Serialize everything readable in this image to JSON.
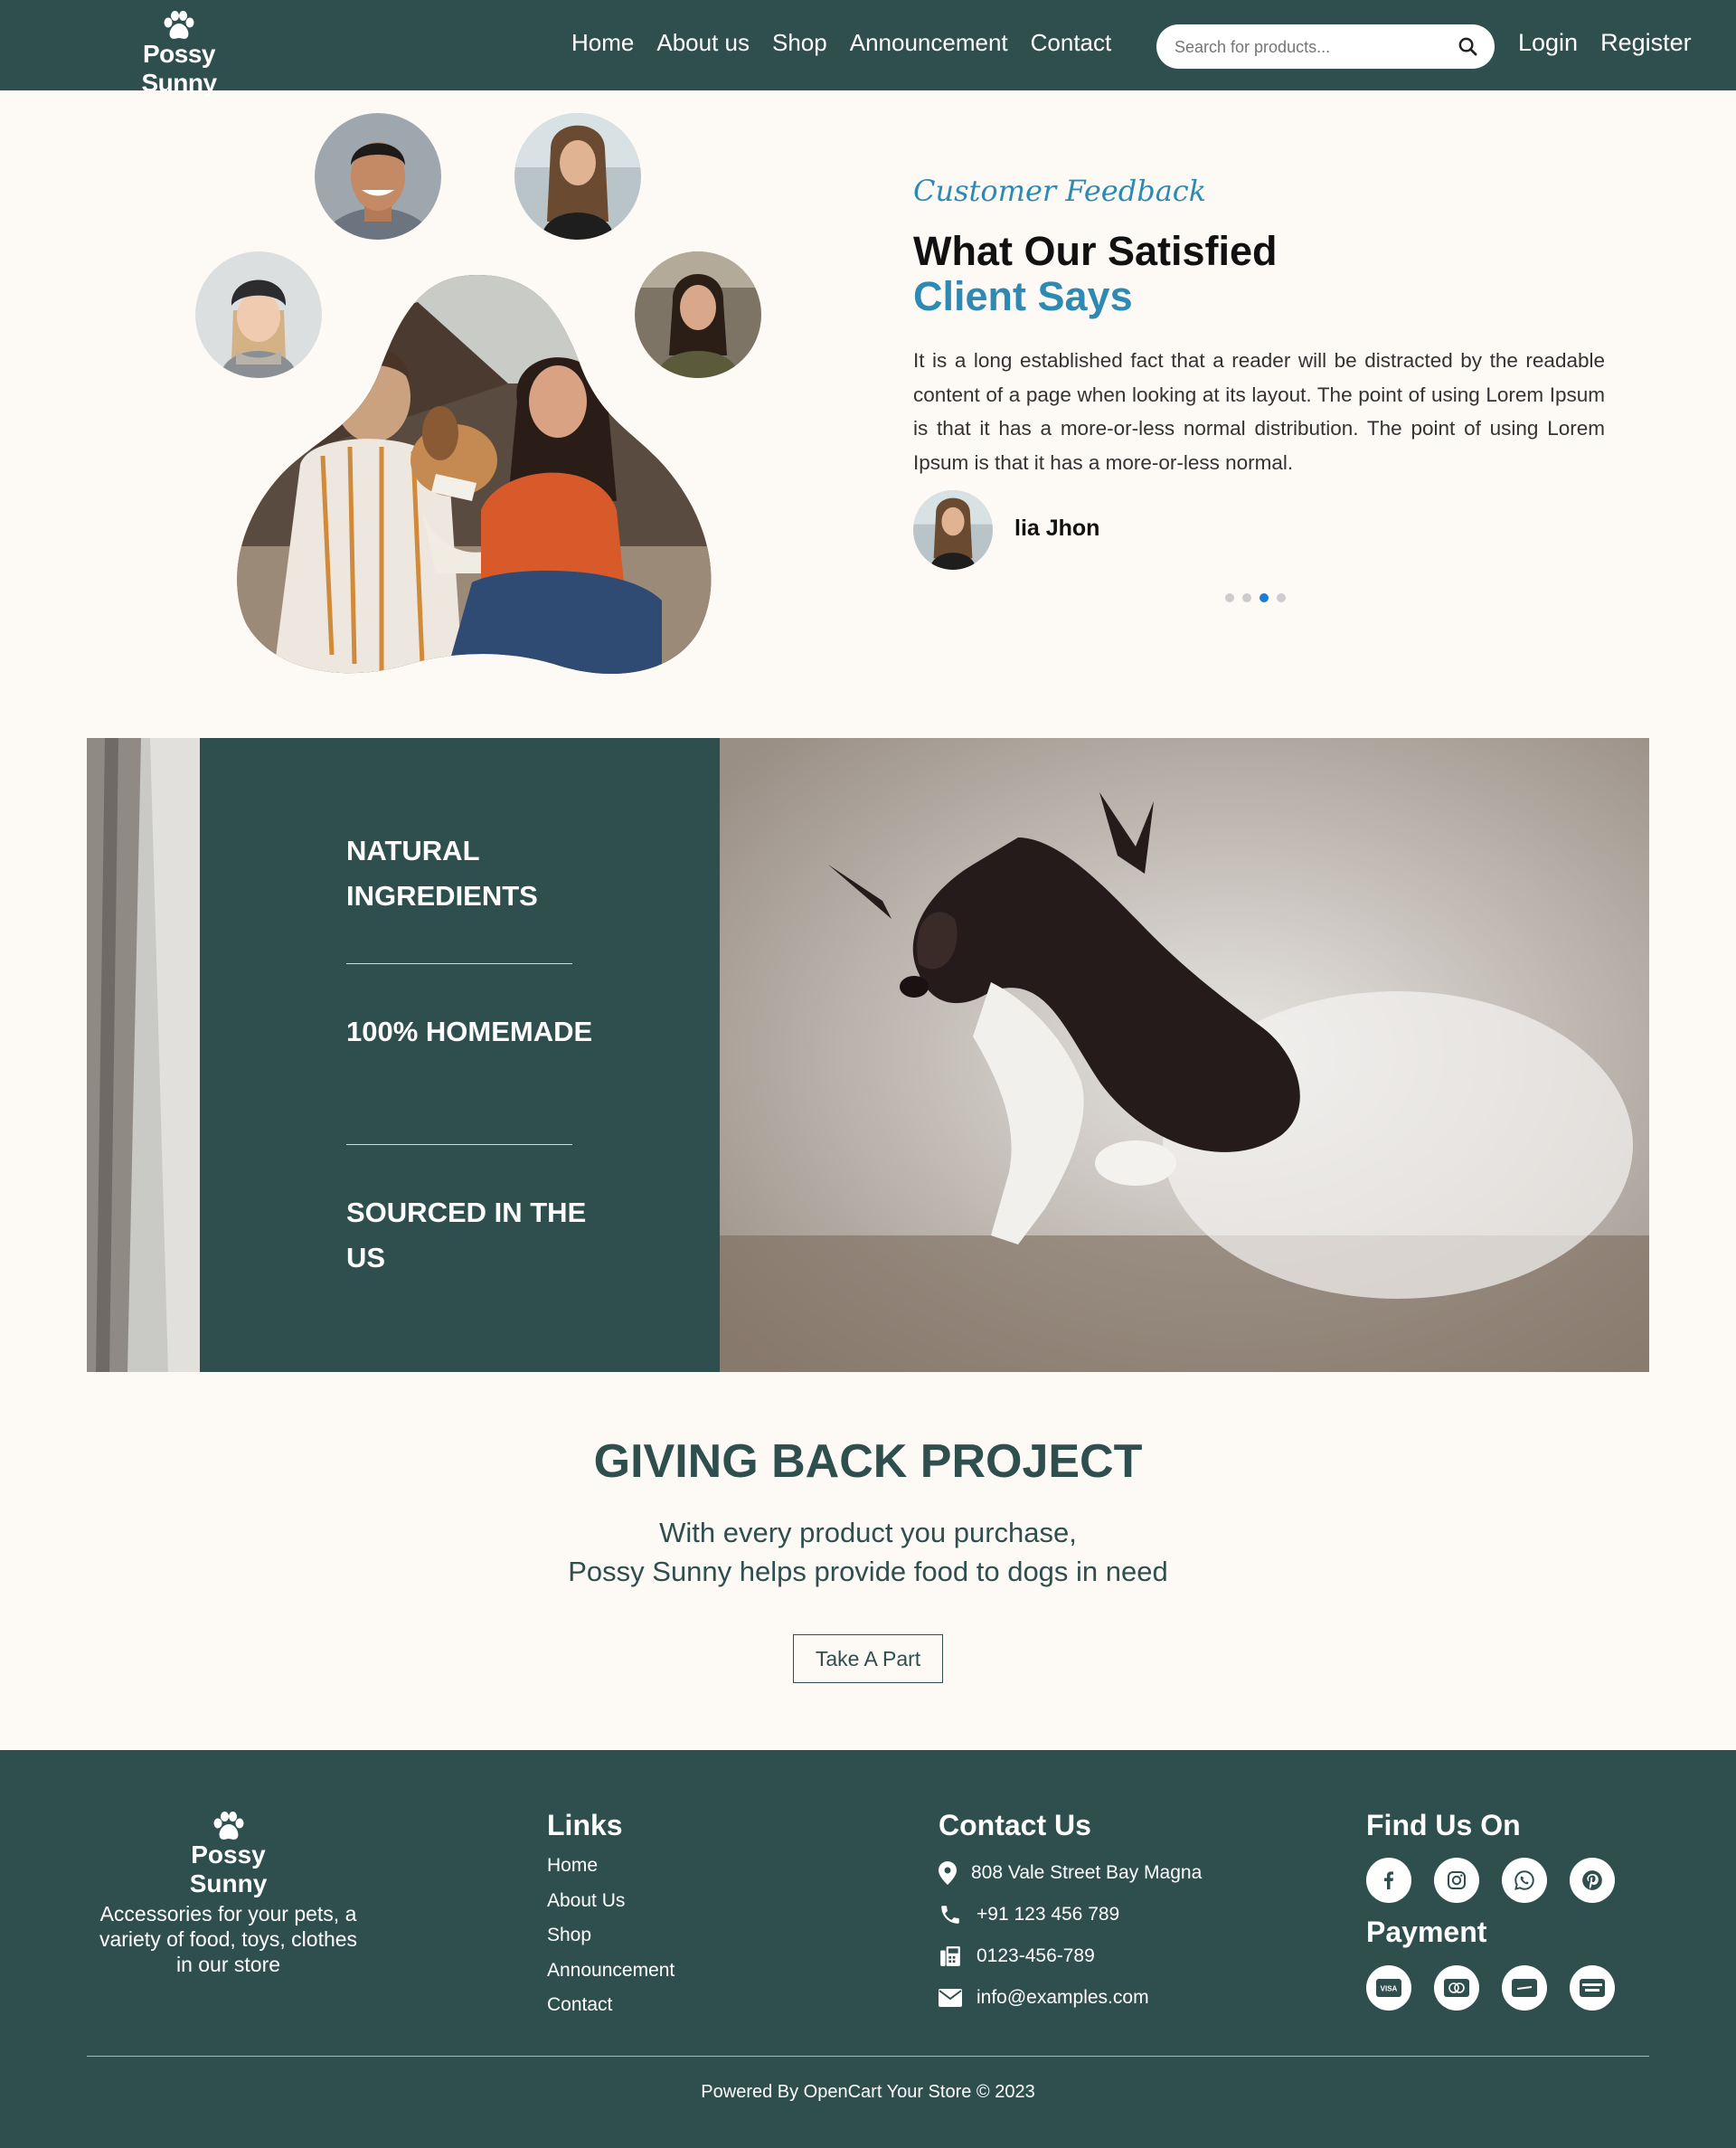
{
  "header": {
    "brand": "Possy Sunny",
    "nav": [
      "Home",
      "About us",
      "Shop",
      "Announcement",
      "Contact"
    ],
    "search_placeholder": "Search for products...",
    "login": "Login",
    "register": "Register"
  },
  "feedback": {
    "eyebrow": "Customer Feedback",
    "title_line1": "What Our Satisfied",
    "title_line2": "Client Says",
    "body": "It is a long established fact that a reader will be distracted by the readable content of a page when looking at its layout. The point of using Lorem Ipsum is that it has a more-or-less normal distribution. The point of using Lorem Ipsum is that it has a more-or-less normal.",
    "author": "lia Jhon",
    "slides_count": 4,
    "active_slide": 3
  },
  "features": {
    "items": [
      "NATURAL INGREDIENTS",
      "100% HOMEMADE",
      "SOURCED IN THE US"
    ]
  },
  "giving_back": {
    "title": "GIVING BACK PROJECT",
    "line1": "With every product you purchase,",
    "line2": "Possy Sunny helps provide food to dogs in need",
    "button": "Take A Part"
  },
  "footer": {
    "brand": "Possy Sunny",
    "description": "Accessories for your pets, a variety of food, toys, clothes in our store",
    "links_heading": "Links",
    "links": [
      "Home",
      "About Us",
      "Shop",
      "Announcement",
      "Contact"
    ],
    "contact_heading": "Contact Us",
    "address": "808 Vale Street Bay Magna",
    "phone": "+91 123 456 789",
    "fax": "0123-456-789",
    "email": "info@examples.com",
    "find_heading": "Find Us On",
    "social_icons": [
      "facebook-icon",
      "instagram-icon",
      "whatsapp-icon",
      "pinterest-icon"
    ],
    "payment_heading": "Payment",
    "payment_icons": [
      "visa-icon",
      "mastercard-icon",
      "paypal-icon",
      "card-icon"
    ],
    "copyright": "Powered By OpenCart Your Store © 2023"
  },
  "colors": {
    "brand_teal": "#2f4f4f",
    "accent_blue": "#2e8ab3",
    "background": "#fdf9f5"
  }
}
